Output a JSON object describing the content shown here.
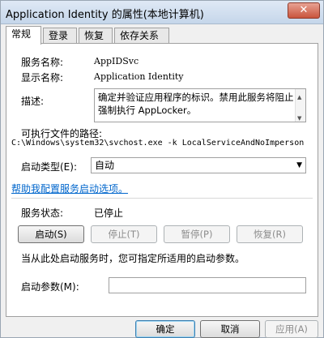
{
  "window": {
    "title": "Application Identity 的属性(本地计算机)",
    "close_glyph": "✕"
  },
  "tabs": [
    {
      "label": "常规"
    },
    {
      "label": "登录"
    },
    {
      "label": "恢复"
    },
    {
      "label": "依存关系"
    }
  ],
  "general": {
    "service_name_label": "服务名称:",
    "service_name_value": "AppIDSvc",
    "display_name_label": "显示名称:",
    "display_name_value": "Application Identity",
    "description_label": "描述:",
    "description_value": "确定并验证应用程序的标识。禁用此服务将阻止强制执行 AppLocker。",
    "exe_path_label": "可执行文件的路径:",
    "exe_path_value": "C:\\Windows\\system32\\svchost.exe -k LocalServiceAndNoImperson",
    "startup_type_label": "启动类型(E):",
    "startup_type_value": "自动",
    "help_link": "帮助我配置服务启动选项。",
    "status_label": "服务状态:",
    "status_value": "已停止",
    "start_button": "启动(S)",
    "stop_button": "停止(T)",
    "pause_button": "暂停(P)",
    "resume_button": "恢复(R)",
    "hint_text": "当从此处启动服务时，您可指定所适用的启动参数。",
    "start_params_label": "启动参数(M):",
    "start_params_value": ""
  },
  "footer": {
    "ok_button": "确定",
    "cancel_button": "取消",
    "apply_button": "应用(A)"
  },
  "icons": {
    "dropdown": "chevron-down-icon",
    "scroll_up": "scroll-up-icon",
    "scroll_down": "scroll-down-icon"
  }
}
